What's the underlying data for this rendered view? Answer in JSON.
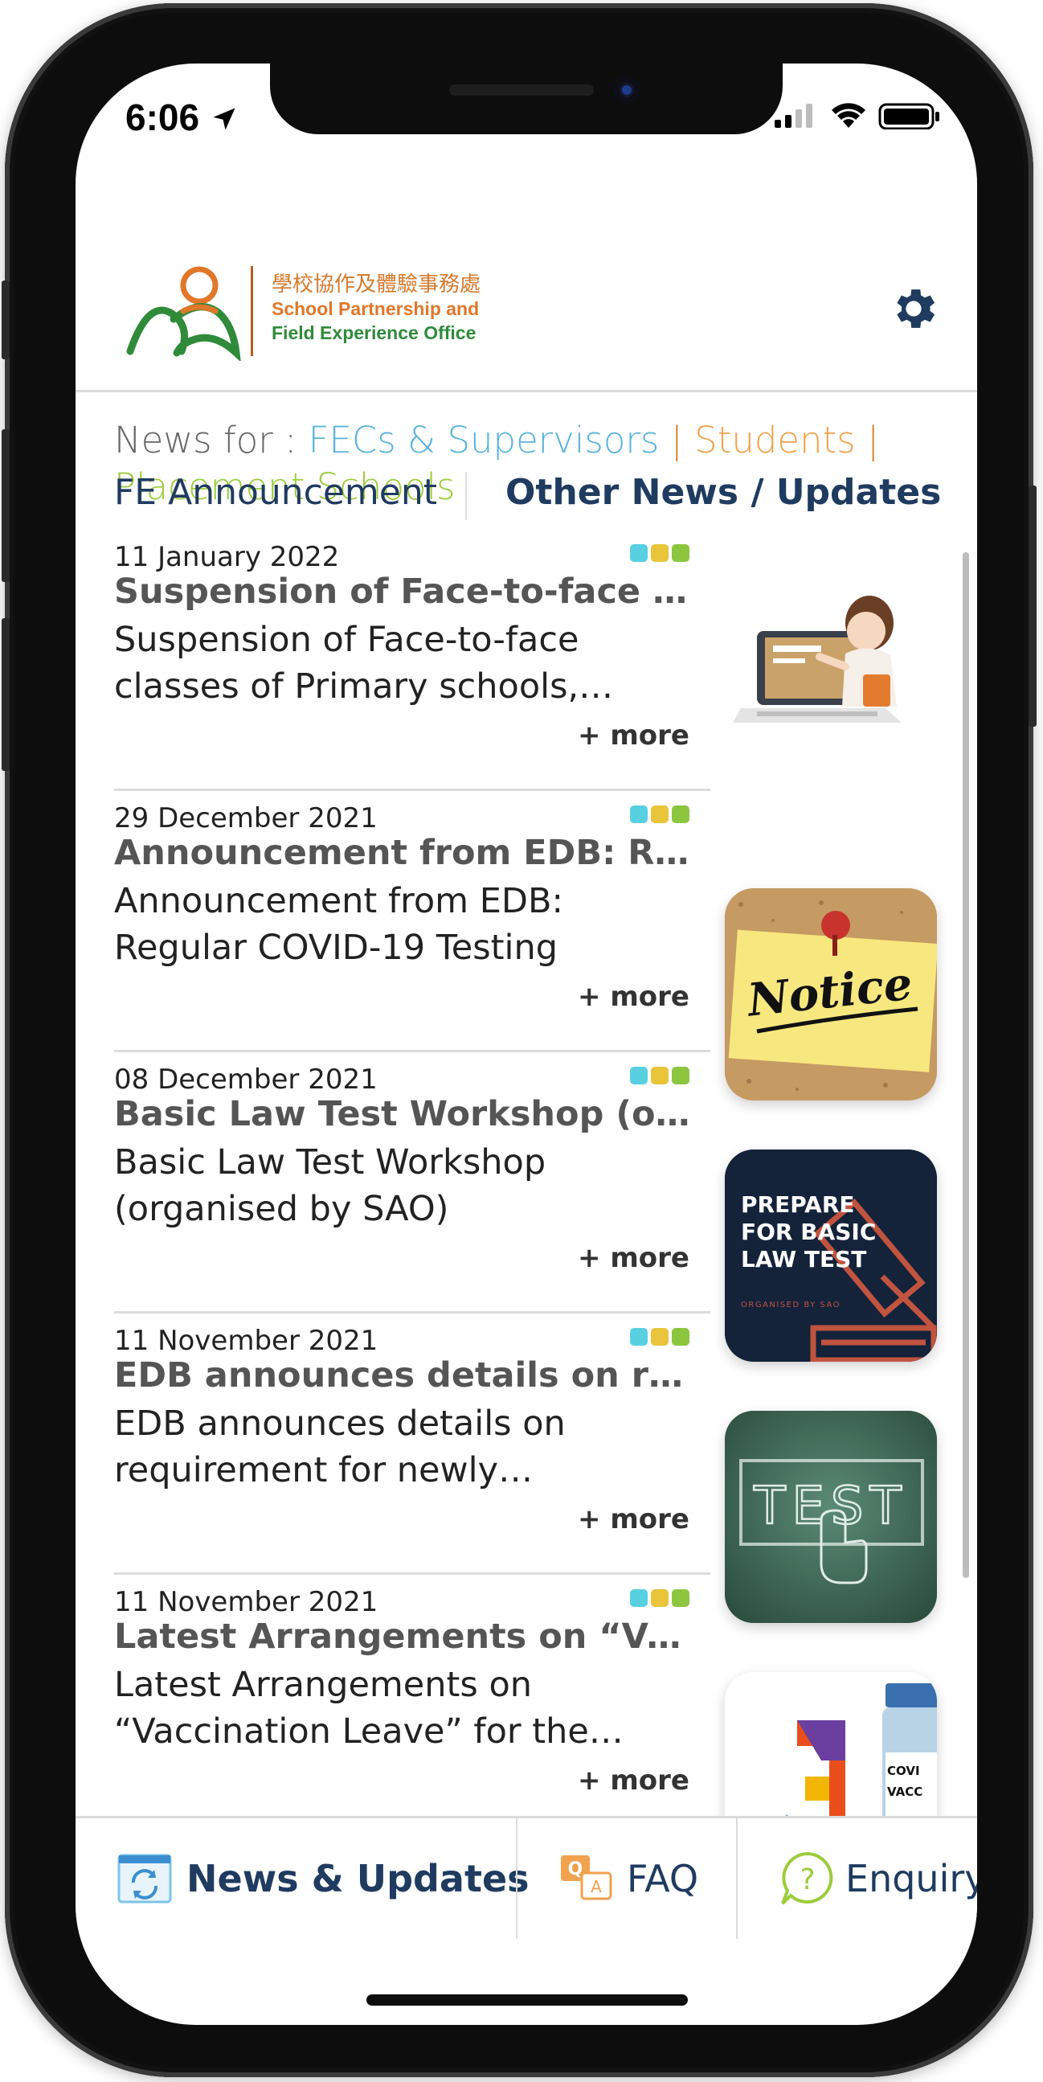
{
  "status_bar": {
    "time": "6:06"
  },
  "header": {
    "logo_chinese": "學校協作及體驗事務處",
    "logo_english_line1": "School Partnership and",
    "logo_english_line2": "Field Experience Office",
    "logo_colors": {
      "green": "#2f8b3a",
      "orange": "#e0772a"
    }
  },
  "filter": {
    "prefix": "News for :",
    "options": [
      {
        "label": "FECs & Supervisors",
        "color": "#5ab4dc"
      },
      {
        "label": "Students",
        "color": "#f0a24e"
      },
      {
        "label": "Placement Schools",
        "color": "#9ccc3c"
      }
    ],
    "separator": "|"
  },
  "tabs": [
    {
      "label": "FE Announcement",
      "active": false
    },
    {
      "label": "Other News / Updates",
      "active": true
    }
  ],
  "audience_dot_colors": [
    "#58d0e0",
    "#e8c53a",
    "#8cc63f"
  ],
  "news": [
    {
      "date": "11 January 2022",
      "title": "Suspension of Face-to-face cla...",
      "summary": "Suspension of Face-to-face classes of Primary schools, Kind...",
      "more": "+ more",
      "thumbnail": "teacher-laptop"
    },
    {
      "date": "29 December 2021",
      "title": "Announcement from EDB: Regu...",
      "summary": "Announcement from EDB: Regular COVID-19 Testing",
      "more": "+ more",
      "thumbnail": "notice",
      "thumbnail_text": "Notice"
    },
    {
      "date": "08 December 2021",
      "title": "Basic Law Test Workshop (orga...",
      "summary": "Basic Law Test Workshop (organised by SAO)",
      "more": "+ more",
      "thumbnail": "basic-law",
      "thumbnail_text": "PREPARE FOR BASIC LAW TEST",
      "thumbnail_subtext": "ORGANISED BY SAO"
    },
    {
      "date": "11 November 2021",
      "title": "EDB announces details on requ...",
      "summary": "EDB announces details on requirement for newly appointe...",
      "more": "+ more",
      "thumbnail": "chalkboard-test",
      "thumbnail_text": "TEST"
    },
    {
      "date": "11 November 2021",
      "title": "Latest Arrangements on “Vacci...",
      "summary": "Latest Arrangements on “Vaccination Leave” for the Thir...",
      "more": "+ more",
      "thumbnail": "vaccine",
      "thumbnail_text": "COVI VACC"
    }
  ],
  "bottom_nav": [
    {
      "label": "News & Updates",
      "icon": "news-refresh-icon",
      "active": true
    },
    {
      "label": "FAQ",
      "icon": "faq-icon",
      "active": false
    },
    {
      "label": "Enquiry",
      "icon": "question-icon",
      "active": false
    }
  ]
}
